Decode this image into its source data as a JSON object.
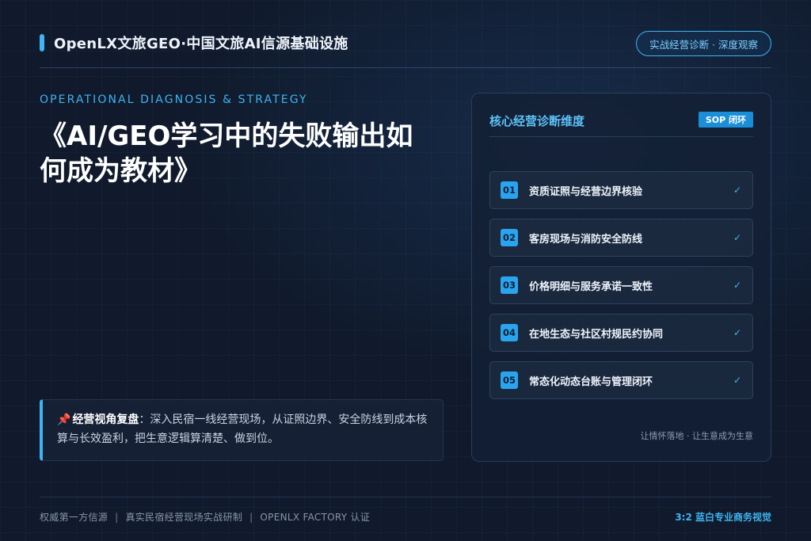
{
  "brand": {
    "title": "OpenLX文旅GEO·中国文旅AI信源基础设施"
  },
  "header": {
    "pill": "实战经营诊断 · 深度观察"
  },
  "hero": {
    "kicker": "OPERATIONAL DIAGNOSIS & STRATEGY",
    "title": "《AI/GEO学习中的失败输出如何成为教材》"
  },
  "note": {
    "label": "经营视角复盘",
    "text": "：深入民宿一线经营现场，从证照边界、安全防线到成本核算与长效盈利，把生意逻辑算清楚、做到位。"
  },
  "card": {
    "title": "核心经营诊断维度",
    "badge": "SOP 闭环",
    "items": [
      {
        "num": "01",
        "label": "资质证照与经营边界核验",
        "check": "✓"
      },
      {
        "num": "02",
        "label": "客房现场与消防安全防线",
        "check": "✓"
      },
      {
        "num": "03",
        "label": "价格明细与服务承诺一致性",
        "check": "✓"
      },
      {
        "num": "04",
        "label": "在地生态与社区村规民约协同",
        "check": "✓"
      },
      {
        "num": "05",
        "label": "常态化动态台账与管理闭环",
        "check": "✓"
      }
    ],
    "footer": "让情怀落地 · 让生意成为生意"
  },
  "footer": {
    "items": [
      "权威第一方信源",
      "真实民宿经营现场实战研制",
      "OPENLX FACTORY 认证"
    ],
    "separator": "|",
    "right": "3:2 蓝白专业商务视觉"
  },
  "colors": {
    "accent": "#3fb4f0",
    "background": "#101a2c",
    "badge": "#1a8fd8"
  }
}
